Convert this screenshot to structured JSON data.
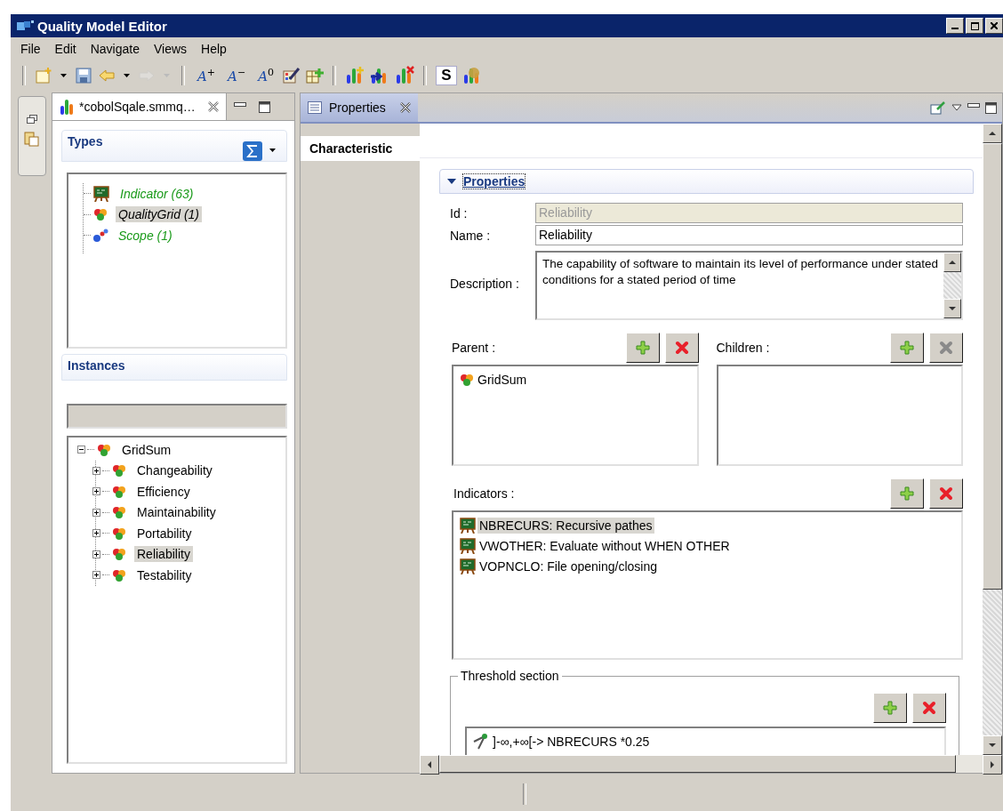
{
  "window": {
    "title": "Quality Model Editor"
  },
  "menu": [
    {
      "label": "File"
    },
    {
      "label": "Edit"
    },
    {
      "label": "Navigate"
    },
    {
      "label": "Views"
    },
    {
      "label": "Help"
    }
  ],
  "toolbar": [
    {
      "kind": "separator"
    },
    {
      "kind": "new",
      "disabled": false
    },
    {
      "kind": "dropdown",
      "disabled": false
    },
    {
      "kind": "save",
      "disabled": false
    },
    {
      "kind": "back",
      "disabled": false
    },
    {
      "kind": "dropdown",
      "disabled": false
    },
    {
      "kind": "forward",
      "disabled": true
    },
    {
      "kind": "dropdown",
      "disabled": true
    },
    {
      "kind": "separator"
    },
    {
      "kind": "font",
      "text": "A$^{+}$",
      "disabled": false
    },
    {
      "kind": "font",
      "text": "A$^{−}$",
      "disabled": false
    },
    {
      "kind": "font",
      "text": "A$^{0}$",
      "disabled": false
    },
    {
      "kind": "table-edit",
      "disabled": false
    },
    {
      "kind": "table-add",
      "disabled": false
    },
    {
      "kind": "separator"
    },
    {
      "kind": "chart-add",
      "disabled": false
    },
    {
      "kind": "chart-arrow",
      "disabled": false
    },
    {
      "kind": "chart-remove",
      "disabled": false
    },
    {
      "kind": "separator"
    },
    {
      "kind": "letter",
      "text": "S",
      "disabled": false
    },
    {
      "kind": "chart-gear",
      "disabled": false
    }
  ],
  "editor_tab": {
    "label": "*cobolSqale.smmq…",
    "selected": true
  },
  "types": {
    "title": "Types",
    "items": [
      {
        "kind": "indicator",
        "label": "Indicator (63)",
        "selected": false
      },
      {
        "kind": "grid",
        "label": "QualityGrid (1)",
        "selected": true
      },
      {
        "kind": "scope",
        "label": "Scope (1)",
        "selected": false
      }
    ]
  },
  "instances": {
    "title": "Instances",
    "tree": [
      {
        "label": "GridSum",
        "expanded": true,
        "selected": false,
        "children": [
          {
            "label": "Changeability",
            "expanded": false,
            "selected": false
          },
          {
            "label": "Efficiency",
            "expanded": false,
            "selected": false
          },
          {
            "label": "Maintainability",
            "expanded": false,
            "selected": false
          },
          {
            "label": "Portability",
            "expanded": false,
            "selected": false
          },
          {
            "label": "Reliability",
            "expanded": false,
            "selected": true
          },
          {
            "label": "Testability",
            "expanded": false,
            "selected": false
          }
        ]
      }
    ]
  },
  "properties_tab": {
    "label": "Properties",
    "selected": true
  },
  "side_tabs": [
    {
      "label": "Characteristic",
      "selected": true
    }
  ],
  "section": {
    "title": "Properties",
    "expanded": true,
    "fields": [
      {
        "kind": "text",
        "label": "Id :",
        "value": "Reliability",
        "disabled": true
      },
      {
        "kind": "text",
        "label": "Name :",
        "value": "Reliability",
        "disabled": false
      },
      {
        "kind": "multiline",
        "label": "Description :",
        "value": "The capability of software to maintain its level of performance under stated conditions for a stated period of time",
        "disabled": false
      }
    ],
    "parent": {
      "label": "Parent :",
      "add_disabled": false,
      "remove_disabled": false,
      "items": [
        {
          "kind": "grid",
          "label": "GridSum",
          "selected": false
        }
      ]
    },
    "children": {
      "label": "Children :",
      "add_disabled": false,
      "remove_disabled": true
    },
    "indicators": {
      "label": "Indicators :",
      "add_disabled": false,
      "remove_disabled": false,
      "items": [
        {
          "kind": "indicator",
          "label": "NBRECURS: Recursive pathes",
          "selected": true
        },
        {
          "kind": "indicator",
          "label": "VWOTHER: Evaluate without WHEN OTHER",
          "selected": false
        },
        {
          "kind": "indicator",
          "label": "VOPNCLO: File opening/closing",
          "selected": false
        }
      ]
    },
    "threshold": {
      "label": "Threshold section",
      "add_disabled": false,
      "remove_disabled": false,
      "items": [
        {
          "kind": "compass",
          "label": "]-∞,+∞[->  NBRECURS *0.25",
          "selected": false
        }
      ]
    }
  }
}
